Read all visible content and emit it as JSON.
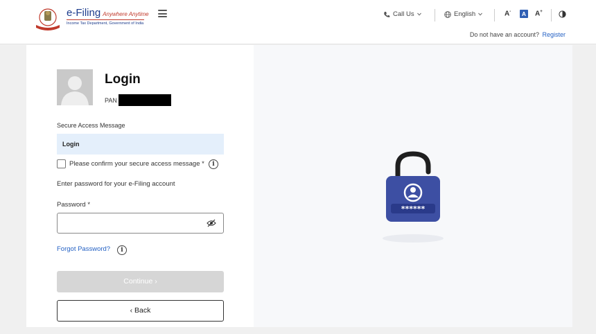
{
  "header": {
    "logo": {
      "title": "e-Filing",
      "tagline": "Anywhere Anytime",
      "subtitle": "Income Tax Department, Government of India"
    },
    "call_us": "Call Us",
    "language": "English",
    "font_decrease": "A",
    "font_normal": "A",
    "font_increase": "A",
    "no_account_text": "Do not have an account?",
    "register_link": "Register"
  },
  "login": {
    "title": "Login",
    "pan_label": "PAN",
    "pan_value": "",
    "secure_access_label": "Secure Access Message",
    "secure_access_value": "Login",
    "confirm_label": "Please confirm your secure access message *",
    "confirm_checked": false,
    "enter_password_text": "Enter password for your e-Filing account",
    "password_label": "Password *",
    "password_value": "",
    "forgot_password": "Forgot Password?",
    "continue_button": "Continue  ›",
    "back_button": "‹  Back"
  },
  "colors": {
    "brand_blue": "#1b3b8c",
    "link_blue": "#2461c4",
    "lock_body": "#3d4fa3",
    "sam_bg": "#e4effb",
    "disabled_button": "#d6d6d6"
  },
  "icons": {
    "menu": "hamburger-icon",
    "phone": "phone-icon",
    "globe": "globe-icon",
    "contrast": "contrast-icon",
    "info": "info-icon",
    "eye": "eye-slash-icon",
    "lock": "padlock-user-icon"
  }
}
